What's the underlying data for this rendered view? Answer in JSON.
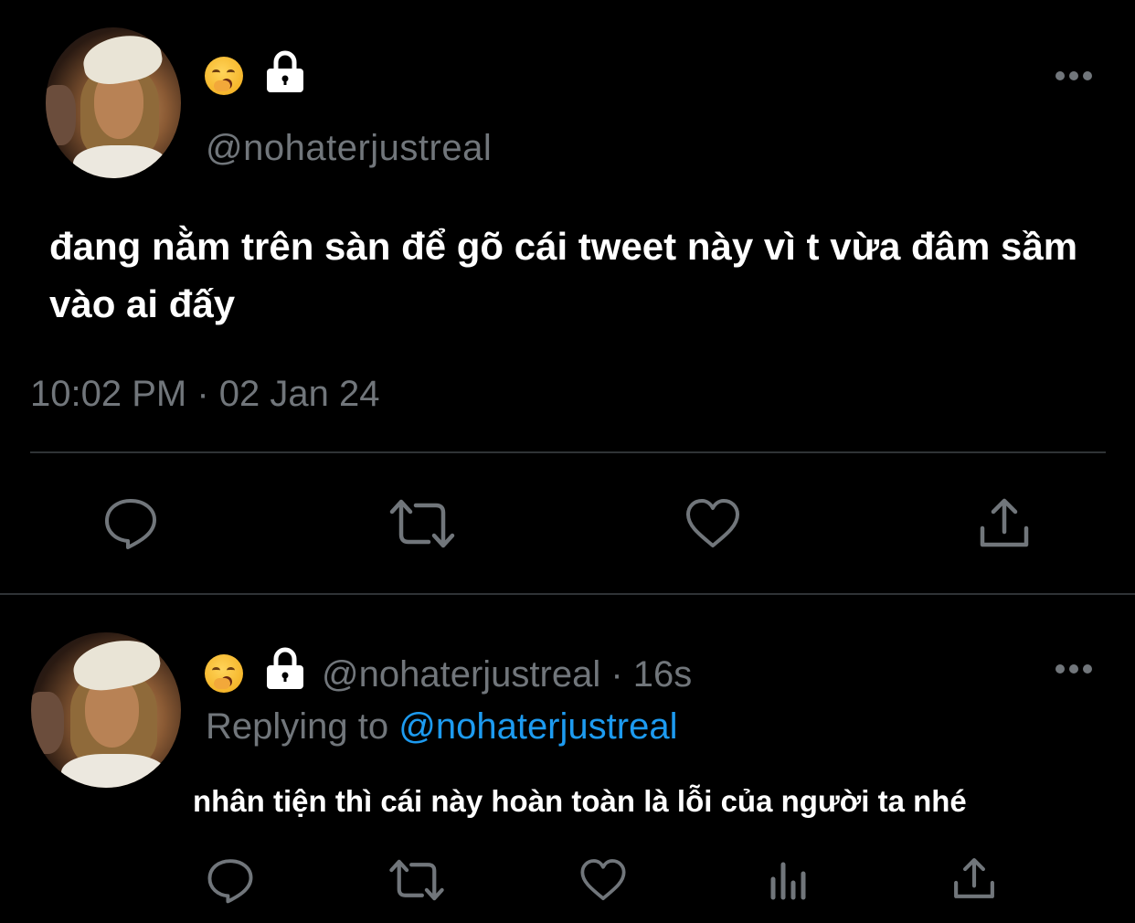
{
  "main_tweet": {
    "avatar_icon": "profile-avatar",
    "emoji_icon": "face-with-hand-over-mouth-emoji",
    "lock_icon": "lock-icon",
    "handle": "@nohaterjustreal",
    "text": "đang nằm trên sàn để gõ cái tweet này vì t vừa đâm sầm vào ai đấy",
    "timestamp": "10:02 PM · 02 Jan 24",
    "actions": [
      "reply-icon",
      "retweet-icon",
      "like-icon",
      "share-icon"
    ]
  },
  "reply_tweet": {
    "avatar_icon": "profile-avatar",
    "emoji_icon": "face-with-hand-over-mouth-emoji",
    "lock_icon": "lock-icon",
    "handle_time": "@nohaterjustreal · 16s",
    "replying_prefix": "Replying to ",
    "replying_mention": "@nohaterjustreal",
    "text": "nhân tiện thì cái này hoàn toàn là lỗi của người ta nhé",
    "actions": [
      "reply-icon",
      "retweet-icon",
      "like-icon",
      "analytics-icon",
      "share-icon"
    ]
  },
  "colors": {
    "background": "#000000",
    "text": "#ffffff",
    "muted": "#71767b",
    "accent": "#1d9bf0",
    "divider": "#2f3336"
  }
}
